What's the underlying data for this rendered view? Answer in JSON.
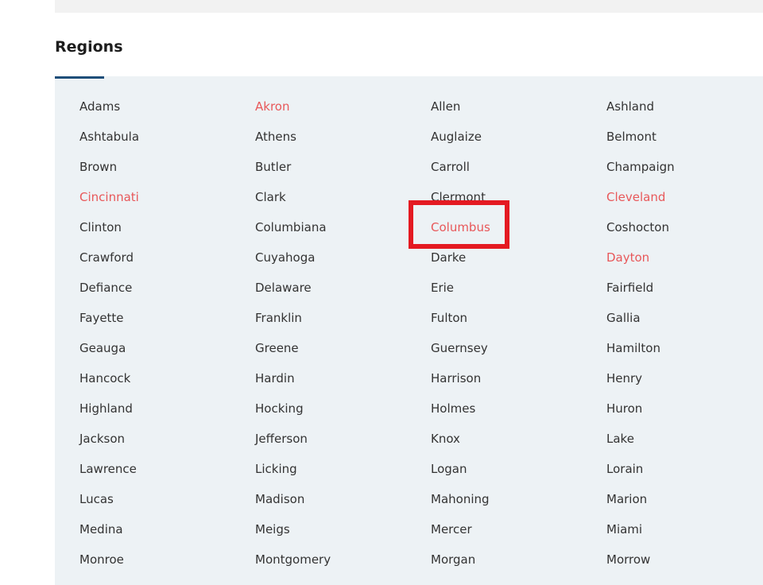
{
  "section": {
    "title": "Regions"
  },
  "colors": {
    "text": "#333333",
    "highlight": "#e8585a",
    "panel_bg": "#edf2f5",
    "underline": "#1e4e79",
    "annotation": "#e41a22"
  },
  "regions": [
    {
      "label": "Adams",
      "highlight": false
    },
    {
      "label": "Akron",
      "highlight": true
    },
    {
      "label": "Allen",
      "highlight": false
    },
    {
      "label": "Ashland",
      "highlight": false
    },
    {
      "label": "Ashtabula",
      "highlight": false
    },
    {
      "label": "Athens",
      "highlight": false
    },
    {
      "label": "Auglaize",
      "highlight": false
    },
    {
      "label": "Belmont",
      "highlight": false
    },
    {
      "label": "Brown",
      "highlight": false
    },
    {
      "label": "Butler",
      "highlight": false
    },
    {
      "label": "Carroll",
      "highlight": false
    },
    {
      "label": "Champaign",
      "highlight": false
    },
    {
      "label": "Cincinnati",
      "highlight": true
    },
    {
      "label": "Clark",
      "highlight": false
    },
    {
      "label": "Clermont",
      "highlight": false
    },
    {
      "label": "Cleveland",
      "highlight": true
    },
    {
      "label": "Clinton",
      "highlight": false
    },
    {
      "label": "Columbiana",
      "highlight": false
    },
    {
      "label": "Columbus",
      "highlight": true,
      "annotated": true
    },
    {
      "label": "Coshocton",
      "highlight": false
    },
    {
      "label": "Crawford",
      "highlight": false
    },
    {
      "label": "Cuyahoga",
      "highlight": false
    },
    {
      "label": "Darke",
      "highlight": false
    },
    {
      "label": "Dayton",
      "highlight": true
    },
    {
      "label": "Defiance",
      "highlight": false
    },
    {
      "label": "Delaware",
      "highlight": false
    },
    {
      "label": "Erie",
      "highlight": false
    },
    {
      "label": "Fairfield",
      "highlight": false
    },
    {
      "label": "Fayette",
      "highlight": false
    },
    {
      "label": "Franklin",
      "highlight": false
    },
    {
      "label": "Fulton",
      "highlight": false
    },
    {
      "label": "Gallia",
      "highlight": false
    },
    {
      "label": "Geauga",
      "highlight": false
    },
    {
      "label": "Greene",
      "highlight": false
    },
    {
      "label": "Guernsey",
      "highlight": false
    },
    {
      "label": "Hamilton",
      "highlight": false
    },
    {
      "label": "Hancock",
      "highlight": false
    },
    {
      "label": "Hardin",
      "highlight": false
    },
    {
      "label": "Harrison",
      "highlight": false
    },
    {
      "label": "Henry",
      "highlight": false
    },
    {
      "label": "Highland",
      "highlight": false
    },
    {
      "label": "Hocking",
      "highlight": false
    },
    {
      "label": "Holmes",
      "highlight": false
    },
    {
      "label": "Huron",
      "highlight": false
    },
    {
      "label": "Jackson",
      "highlight": false
    },
    {
      "label": "Jefferson",
      "highlight": false
    },
    {
      "label": "Knox",
      "highlight": false
    },
    {
      "label": "Lake",
      "highlight": false
    },
    {
      "label": "Lawrence",
      "highlight": false
    },
    {
      "label": "Licking",
      "highlight": false
    },
    {
      "label": "Logan",
      "highlight": false
    },
    {
      "label": "Lorain",
      "highlight": false
    },
    {
      "label": "Lucas",
      "highlight": false
    },
    {
      "label": "Madison",
      "highlight": false
    },
    {
      "label": "Mahoning",
      "highlight": false
    },
    {
      "label": "Marion",
      "highlight": false
    },
    {
      "label": "Medina",
      "highlight": false
    },
    {
      "label": "Meigs",
      "highlight": false
    },
    {
      "label": "Mercer",
      "highlight": false
    },
    {
      "label": "Miami",
      "highlight": false
    },
    {
      "label": "Monroe",
      "highlight": false
    },
    {
      "label": "Montgomery",
      "highlight": false
    },
    {
      "label": "Morgan",
      "highlight": false
    },
    {
      "label": "Morrow",
      "highlight": false
    }
  ]
}
